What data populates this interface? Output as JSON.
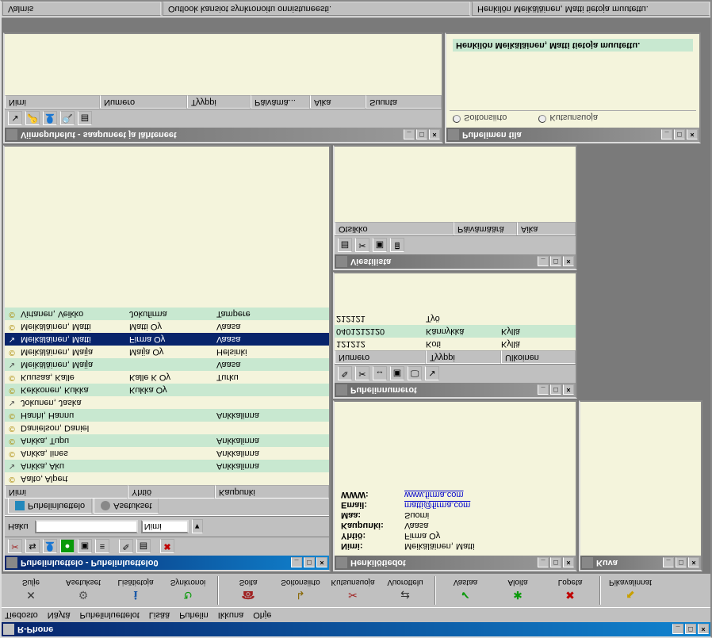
{
  "title": "R-Phone",
  "menu": [
    "Tiedosto",
    "Näytä",
    "Puhelinluettelot",
    "Lisää",
    "Puhelin",
    "Ikkuna",
    "Ohje"
  ],
  "toolbar": [
    {
      "label": "Sulje",
      "icon": "✕",
      "color": "#333"
    },
    {
      "label": "Asetukset",
      "icon": "⚙",
      "color": "#555"
    },
    {
      "label": "Lisätietoja",
      "icon": "ℹ",
      "color": "#1858a8"
    },
    {
      "label": "Synkronoi",
      "icon": "↻",
      "color": "#0a9a0a"
    },
    {
      "sep": true
    },
    {
      "label": "Soita",
      "icon": "☎",
      "color": "#a02020"
    },
    {
      "label": "Soitonsiirto",
      "icon": "↳",
      "color": "#886600"
    },
    {
      "label": "Kutsunsuoja",
      "icon": "✂",
      "color": "#a02020"
    },
    {
      "label": "Vuorottelu",
      "icon": "⇄",
      "color": "#333"
    },
    {
      "sep": true
    },
    {
      "label": "Vastaa",
      "icon": "✔",
      "color": "#0a9a0a"
    },
    {
      "label": "Aloita",
      "icon": "✱",
      "color": "#0a9a0a"
    },
    {
      "label": "Lopeta",
      "icon": "✖",
      "color": "#c00000"
    },
    {
      "sep": true
    },
    {
      "label": "Pikavalinnat",
      "icon": "⬉",
      "color": "#c8a000"
    }
  ],
  "pb": {
    "title": "Puhelinluettelo - Puhelinluettelo0",
    "haku_label": "Haku",
    "search_field_label": "Nimi",
    "tabs": [
      "Puhelinluettelo",
      "Asetukset"
    ],
    "cols": [
      "Nimi",
      "Yhtiö",
      "Kaupunki"
    ],
    "rows": [
      {
        "icon": "C",
        "name": "Aalto, Alpert",
        "co": "",
        "city": ""
      },
      {
        "icon": "↘",
        "name": "Ankka, Aku",
        "co": "",
        "city": "Ankkalinna",
        "even": true
      },
      {
        "icon": "C",
        "name": "Ankka, Iines",
        "co": "",
        "city": "Ankkalinna"
      },
      {
        "icon": "C",
        "name": "Ankka, Tupu",
        "co": "",
        "city": "Ankkalinna",
        "even": true
      },
      {
        "icon": "C",
        "name": "Danielson, Daniel",
        "co": "",
        "city": ""
      },
      {
        "icon": "C",
        "name": "Hanhi, Hannu",
        "co": "",
        "city": "Ankkalinna",
        "even": true
      },
      {
        "icon": "↘",
        "name": "Jokunen, Jaska",
        "co": "",
        "city": ""
      },
      {
        "icon": "C",
        "name": "Kekkonen, Kukka",
        "co": "Kukka Oy",
        "city": "",
        "even": true
      },
      {
        "icon": "C",
        "name": "Kuusaa, Kalle",
        "co": "Kalle K Oy",
        "city": "Turku"
      },
      {
        "icon": "↘",
        "name": "Meikäläinen, Maija",
        "co": "",
        "city": "Vaasa",
        "even": true
      },
      {
        "icon": "C",
        "name": "Meikäläinen, Maija",
        "co": "Maija Oy",
        "city": "Helsinki"
      },
      {
        "icon": "↘",
        "name": "Meikäläinen, Matti",
        "co": "Firma Oy",
        "city": "Vaasa",
        "sel": true
      },
      {
        "icon": "C",
        "name": "Meikäläinen, Matti",
        "co": "Matti Oy",
        "city": "Vaasa"
      },
      {
        "icon": "C",
        "name": "Virtanen, Veikko",
        "co": "Jokufirma",
        "city": "Tampere",
        "even": true
      }
    ]
  },
  "details": {
    "title": "Henkilötiedot",
    "rows": [
      {
        "l": "Nimi:",
        "v": "Meikäläinen, Matti"
      },
      {
        "l": "Yhtiö:",
        "v": "Firma Oy"
      },
      {
        "l": "Kaupunki:",
        "v": "Vaasa"
      },
      {
        "l": "Maa:",
        "v": "Suomi"
      },
      {
        "l": "Email:",
        "v": "matti@firma.com",
        "link": true
      },
      {
        "l": "WWW:",
        "v": "www.firma.com",
        "link": true
      }
    ]
  },
  "kuva": {
    "title": "Kuva"
  },
  "numbers": {
    "title": "Puhelinnumerot",
    "cols": [
      "Numero",
      "Tyyppi",
      "Ulkoinen"
    ],
    "rows": [
      {
        "n": "121212",
        "t": "Koti",
        "u": "Kyllä"
      },
      {
        "n": "0401212120",
        "t": "Kännykkä",
        "u": "Kyllä",
        "even": true
      },
      {
        "n": "212121",
        "t": "Työ",
        "u": ""
      }
    ]
  },
  "messages": {
    "title": "Viestilista",
    "cols": [
      "Otsikko",
      "Päivämäärä",
      "Aika"
    ]
  },
  "phone": {
    "title": "Puhelimen tila",
    "opts": [
      "Soitonsiirto",
      "Kutsunsuoja"
    ],
    "msg": "Henkilön Meikäläinen, Matti tietoja muutettu."
  },
  "recent": {
    "title": "Viimepuhelut - saapuneet ja lähteneet",
    "cols": [
      "Nimi",
      "Numero",
      "Tyyppi",
      "Päivämä...",
      "Aika",
      "Suunta"
    ]
  },
  "status": [
    "Valmis",
    "Outlook kansiot synkronoitu onnistuneesti.",
    "Henkilön Meikäläinen, Matti tietoja muutettu."
  ]
}
